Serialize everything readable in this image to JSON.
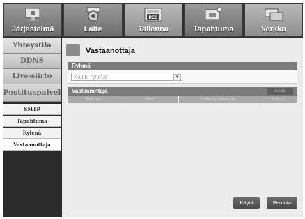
{
  "tabs": [
    {
      "label": "Järjestelmä",
      "icon": "monitor-icon"
    },
    {
      "label": "Laite",
      "icon": "camera-icon"
    },
    {
      "label": "Tallenna",
      "icon": "rec-icon"
    },
    {
      "label": "Tapahtuma",
      "icon": "event-icon"
    },
    {
      "label": "Verkko",
      "icon": "network-icon"
    }
  ],
  "sidebar": {
    "items": [
      "Yhteystila",
      "DDNS",
      "Live-siirto",
      "Postituspalvel"
    ],
    "subitems": [
      "SMTP",
      "Tapahtuma",
      "Kylenä",
      "Vastaanottaja"
    ]
  },
  "panel": {
    "title": "Vastaanottaja",
    "group_label": "Ryhmä",
    "group_select_value": "Kaikki ryhmät",
    "receiver_label": "Vastaanottaja",
    "add_label": "Lisää",
    "columns": [
      "Ryhmä",
      "Nimi",
      "Sähköpostiosoite",
      "Poista"
    ],
    "apply_label": "Käytä",
    "cancel_label": "Peruuta"
  }
}
